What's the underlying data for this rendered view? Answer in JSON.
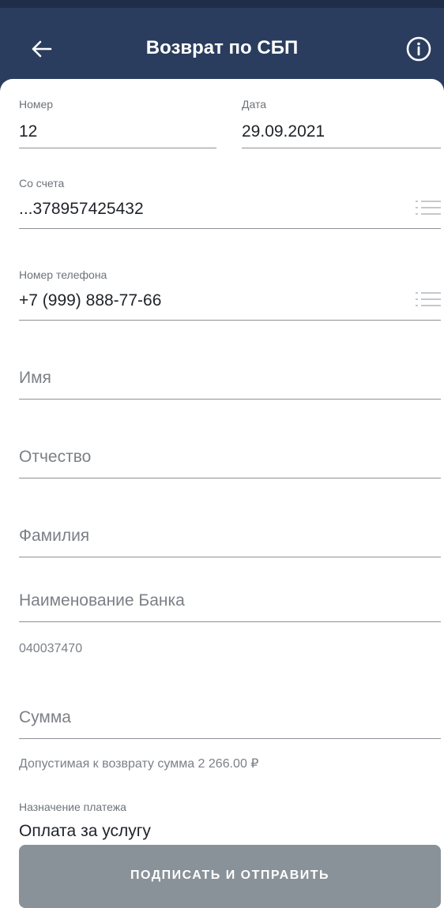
{
  "header": {
    "title": "Возврат по СБП",
    "back_icon": "arrow-left-icon",
    "info_icon": "info-icon",
    "bg_color": "#2b3d5e"
  },
  "form": {
    "number": {
      "label": "Номер",
      "value": "12"
    },
    "date": {
      "label": "Дата",
      "value": "29.09.2021"
    },
    "account": {
      "label": "Со счета",
      "value": "...378957425432",
      "icon": "list-icon"
    },
    "phone": {
      "label": "Номер телефона",
      "value": "+7 (999) 888-77-66",
      "icon": "list-icon"
    },
    "first_name": {
      "placeholder": "Имя"
    },
    "patronymic": {
      "placeholder": "Отчество"
    },
    "last_name": {
      "placeholder": "Фамилия"
    },
    "bank_name": {
      "placeholder": "Наименование Банка",
      "helper": "040037470"
    },
    "amount": {
      "placeholder": "Сумма",
      "helper": "Допустимая к возврату сумма 2 266.00 ₽"
    },
    "purpose": {
      "label": "Назначение платежа",
      "value": "Оплата за услугу"
    }
  },
  "submit": {
    "label": "ПОДПИСАТЬ И ОТПРАВИТЬ",
    "bg_color": "#8a9299"
  }
}
